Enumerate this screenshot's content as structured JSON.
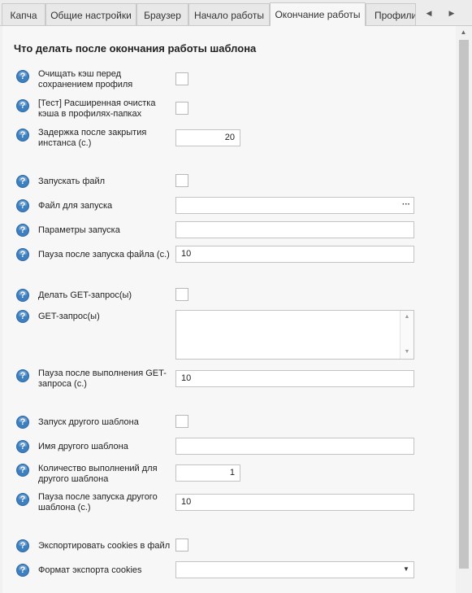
{
  "tabs": [
    {
      "label": "Капча",
      "active": false
    },
    {
      "label": "Общие настройки",
      "active": false
    },
    {
      "label": "Браузер",
      "active": false
    },
    {
      "label": "Начало работы",
      "active": false
    },
    {
      "label": "Окончание работы",
      "active": true
    },
    {
      "label": "Профили",
      "active": false
    }
  ],
  "tab_nav": {
    "left_icon": "chevron-left-icon",
    "right_icon": "chevron-right-icon"
  },
  "section_title": "Что делать после окончания работы шаблона",
  "fields": {
    "clear_cache": {
      "label": "Очищать кэш перед сохранением профиля",
      "checked": false
    },
    "ext_clear_cache": {
      "label": "[Тест] Расширенная очистка кэша в профилях-папках",
      "checked": false
    },
    "close_delay": {
      "label": "Задержка после закрытия инстанса (с.)",
      "value": "20"
    },
    "run_file": {
      "label": "Запускать файл",
      "checked": false
    },
    "file_to_run": {
      "label": "Файл для запуска",
      "value": "",
      "button": "···"
    },
    "run_params": {
      "label": "Параметры запуска",
      "value": ""
    },
    "pause_after_file": {
      "label": "Пауза после запуска файла (с.)",
      "value": "10"
    },
    "do_get": {
      "label": "Делать GET-запрос(ы)",
      "checked": false
    },
    "get_requests": {
      "label": "GET-запрос(ы)",
      "value": ""
    },
    "pause_after_get": {
      "label": "Пауза после выполнения GET-запроса (с.)",
      "value": "10"
    },
    "run_other_template": {
      "label": "Запуск другого шаблона",
      "checked": false
    },
    "other_template_name": {
      "label": "Имя другого шаблона",
      "value": ""
    },
    "other_template_runs": {
      "label": "Количество выполнений для другого шаблона",
      "value": "1"
    },
    "pause_after_other": {
      "label": "Пауза после запуска другого шаблона (с.)",
      "value": "10"
    },
    "export_cookies": {
      "label": "Экспортировать cookies в файл",
      "checked": false
    },
    "cookie_format": {
      "label": "Формат экспорта cookies",
      "value": ""
    }
  },
  "colors": {
    "help_icon": "#3d7fbf",
    "panel_bg": "#f7f7f7",
    "scroll_thumb": "#c4c4c4"
  },
  "icons": {
    "help": "question-icon",
    "dropdown": "chevron-down-icon"
  }
}
